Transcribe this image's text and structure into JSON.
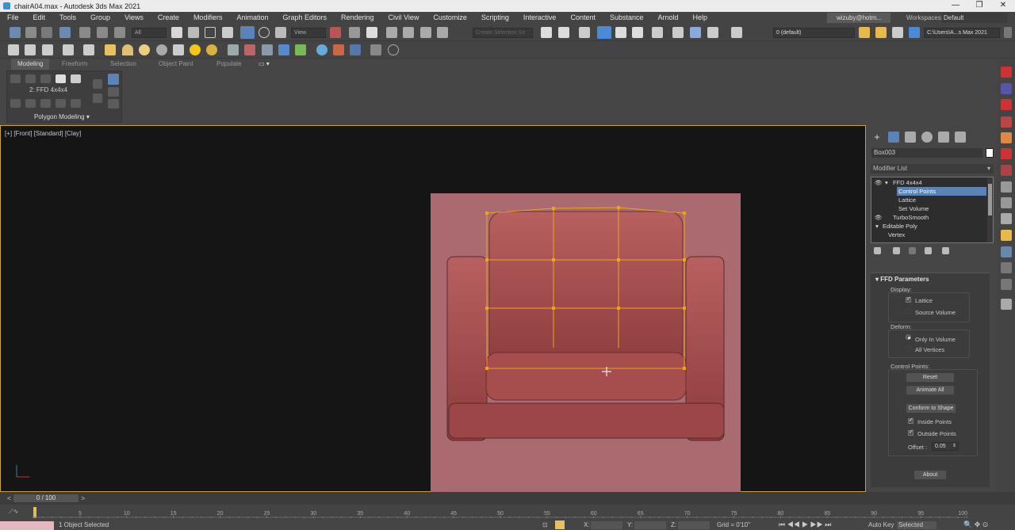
{
  "window": {
    "title": "chairA04.max - Autodesk 3ds Max 2021"
  },
  "menu": [
    "File",
    "Edit",
    "Tools",
    "Group",
    "Views",
    "Create",
    "Modifiers",
    "Animation",
    "Graph Editors",
    "Rendering",
    "Civil View",
    "Customize",
    "Scripting",
    "Interactive",
    "Content",
    "Substance",
    "Arnold",
    "Help"
  ],
  "account": {
    "user": "wizuby@hotm...",
    "workspaces_label": "Workspaces:",
    "workspace": "Default"
  },
  "toolbar": {
    "selection_filter": "All",
    "ref_coord": "View",
    "named_selection_placeholder": "Create Selection Se",
    "layer": "0 (default)",
    "project_path": "C:\\Users\\A...s Max 2021"
  },
  "ribbon": {
    "tabs": [
      "Modeling",
      "Freeform",
      "Selection",
      "Object Paint",
      "Populate"
    ],
    "active_tab": "Modeling",
    "panel_label": "Polygon Modeling",
    "current_modifier": "2: FFD 4x4x4"
  },
  "viewport": {
    "label": "[+] [Front] [Standard] [Clay]"
  },
  "command_panel": {
    "object_name": "Box003",
    "modifier_list": "Modifier List",
    "stack": [
      {
        "label": "FFD 4x4x4",
        "selected": false,
        "eye": true,
        "expand": true
      },
      {
        "label": "Control Points",
        "selected": true,
        "eye": false,
        "expand": false
      },
      {
        "label": "Lattice",
        "selected": false,
        "eye": false,
        "expand": false
      },
      {
        "label": "Set Volume",
        "selected": false,
        "eye": false,
        "expand": false
      },
      {
        "label": "TurboSmooth",
        "selected": false,
        "eye": true,
        "expand": false
      },
      {
        "label": "Editable Poly",
        "selected": false,
        "eye": false,
        "expand": true
      },
      {
        "label": "Vertex",
        "selected": false,
        "eye": false,
        "expand": false
      }
    ],
    "params": {
      "title": "FFD Parameters",
      "display_label": "Display:",
      "lattice": {
        "label": "Lattice",
        "checked": true
      },
      "source_volume": {
        "label": "Source Volume",
        "checked": false
      },
      "deform_label": "Deform:",
      "only_in_volume": {
        "label": "Only In Volume",
        "selected": true
      },
      "all_vertices": {
        "label": "All Vertices",
        "selected": false
      },
      "control_points_label": "Control Points:",
      "reset": "Reset",
      "animate_all": "Animate All",
      "conform": "Conform to Shape",
      "inside_points": {
        "label": "Inside Points",
        "checked": true
      },
      "outside_points": {
        "label": "Outside Points",
        "checked": true
      },
      "offset_label": "Offset :",
      "offset_value": "0.05",
      "about": "About"
    }
  },
  "timeline": {
    "frame_display": "0 / 100",
    "ticks": [
      "0",
      "5",
      "10",
      "15",
      "20",
      "25",
      "30",
      "35",
      "40",
      "45",
      "50",
      "55",
      "60",
      "65",
      "70",
      "75",
      "80",
      "85",
      "90",
      "95",
      "100"
    ]
  },
  "status": {
    "selected": "1 Object Selected",
    "x_label": "X:",
    "y_label": "Y:",
    "z_label": "Z:",
    "grid": "Grid = 0'10\"",
    "auto_key": "Auto Key",
    "key_mode": "Selected"
  },
  "colors": {
    "selection": "#c8a23c",
    "lattice": "#f0a21e",
    "chair": "#a84f4f",
    "background_plane": "#a96b6f",
    "stack_selected": "#5a83b7"
  }
}
